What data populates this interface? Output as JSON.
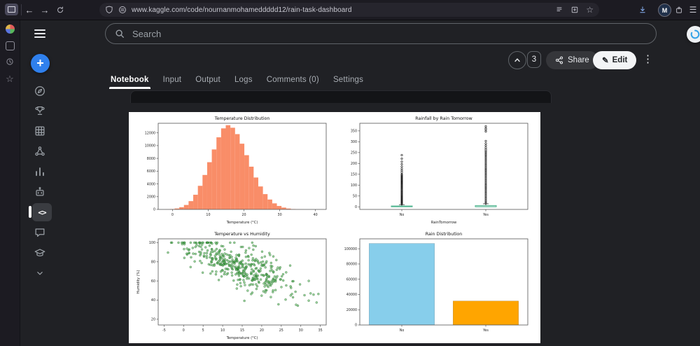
{
  "browser": {
    "url": "www.kaggle.com/code/nournanmohameddddd12/rain-task-dashboard",
    "avatar_letter": "M"
  },
  "icons": {
    "back": "←",
    "forward": "→",
    "star": "☆",
    "kebab": "⋮",
    "menu": "☰",
    "pencil": "✎",
    "plus": "+",
    "code": "<>"
  },
  "kaggle": {
    "search_placeholder": "Search",
    "upvote_count": "3",
    "share_label": "Share",
    "edit_label": "Edit",
    "tabs": [
      {
        "label": "Notebook",
        "active": true
      },
      {
        "label": "Input",
        "active": false
      },
      {
        "label": "Output",
        "active": false
      },
      {
        "label": "Logs",
        "active": false
      },
      {
        "label": "Comments (0)",
        "active": false
      },
      {
        "label": "Settings",
        "active": false
      }
    ]
  },
  "colors": {
    "accent_blue": "#2f80ed",
    "histogram": "#f98d68",
    "scatter_green": "#4caf50",
    "bar_no": "#87ceeb",
    "bar_yes": "#ffa500"
  },
  "chart_data": [
    {
      "type": "histogram",
      "title": "Temperature Distribution",
      "xlabel": "Temperature (°C)",
      "bin_start": -2,
      "bin_width": 1.3,
      "counts": [
        20,
        60,
        150,
        350,
        700,
        1300,
        2300,
        3700,
        5400,
        7400,
        9400,
        11300,
        12700,
        13200,
        12800,
        11800,
        10300,
        8500,
        6700,
        5000,
        3600,
        2400,
        1550,
        950,
        540,
        290,
        140,
        60,
        25,
        10
      ],
      "color": "#f98d68",
      "xlim": [
        -4,
        43
      ],
      "ylim": [
        0,
        13500
      ],
      "xticks": [
        0,
        10,
        20,
        30,
        40
      ],
      "yticks": [
        0,
        2000,
        4000,
        6000,
        8000,
        10000,
        12000
      ]
    },
    {
      "type": "boxplot",
      "title": "Rainfall by Rain Tomorrow",
      "xlabel": "RainTomorrow",
      "categories": [
        "No",
        "Yes"
      ],
      "box_color": "#57b894",
      "ylim": [
        -12,
        385
      ],
      "yticks": [
        0,
        50,
        100,
        150,
        200,
        250,
        300,
        350
      ],
      "boxes": [
        {
          "q1": 0,
          "median": 1,
          "q3": 4,
          "whisker_low": 0,
          "whisker_high": 10,
          "outliers_dense": [
            12,
            150
          ],
          "outliers_sparse": [
            158,
            166,
            175,
            185,
            196,
            208,
            222,
            238
          ]
        },
        {
          "q1": 0,
          "median": 1,
          "q3": 6,
          "whisker_low": 0,
          "whisker_high": 14,
          "outliers_dense": [
            16,
            252
          ],
          "outliers_sparse": [
            258,
            265,
            273,
            282,
            292,
            303,
            347,
            355,
            362,
            371
          ]
        }
      ]
    },
    {
      "type": "scatter",
      "title": "Temperature vs Humidity",
      "xlabel": "Temperature (°C)",
      "ylabel": "Humidity (%)",
      "n": 430,
      "seed": 7,
      "x_mean": 14.5,
      "x_sd": 6.8,
      "x_min": -4,
      "x_max": 34.5,
      "y_intercept": 98,
      "y_slope": -1.55,
      "y_noise_sd": 11,
      "y_min": 19,
      "y_max": 100,
      "color": "#4caf50",
      "edge_color": "#1b5e20",
      "xlim": [
        -6.5,
        36.5
      ],
      "ylim": [
        14,
        104
      ],
      "xticks": [
        -5,
        0,
        5,
        10,
        15,
        20,
        25,
        30,
        35
      ],
      "yticks": [
        20,
        40,
        60,
        80,
        100
      ]
    },
    {
      "type": "bar",
      "title": "Rain Distribution",
      "categories": [
        "No",
        "Yes"
      ],
      "values": [
        107000,
        31500
      ],
      "colors": [
        "#87ceeb",
        "#ffa500"
      ],
      "ylim": [
        0,
        113000
      ],
      "yticks": [
        0,
        20000,
        40000,
        60000,
        80000,
        100000
      ]
    }
  ]
}
